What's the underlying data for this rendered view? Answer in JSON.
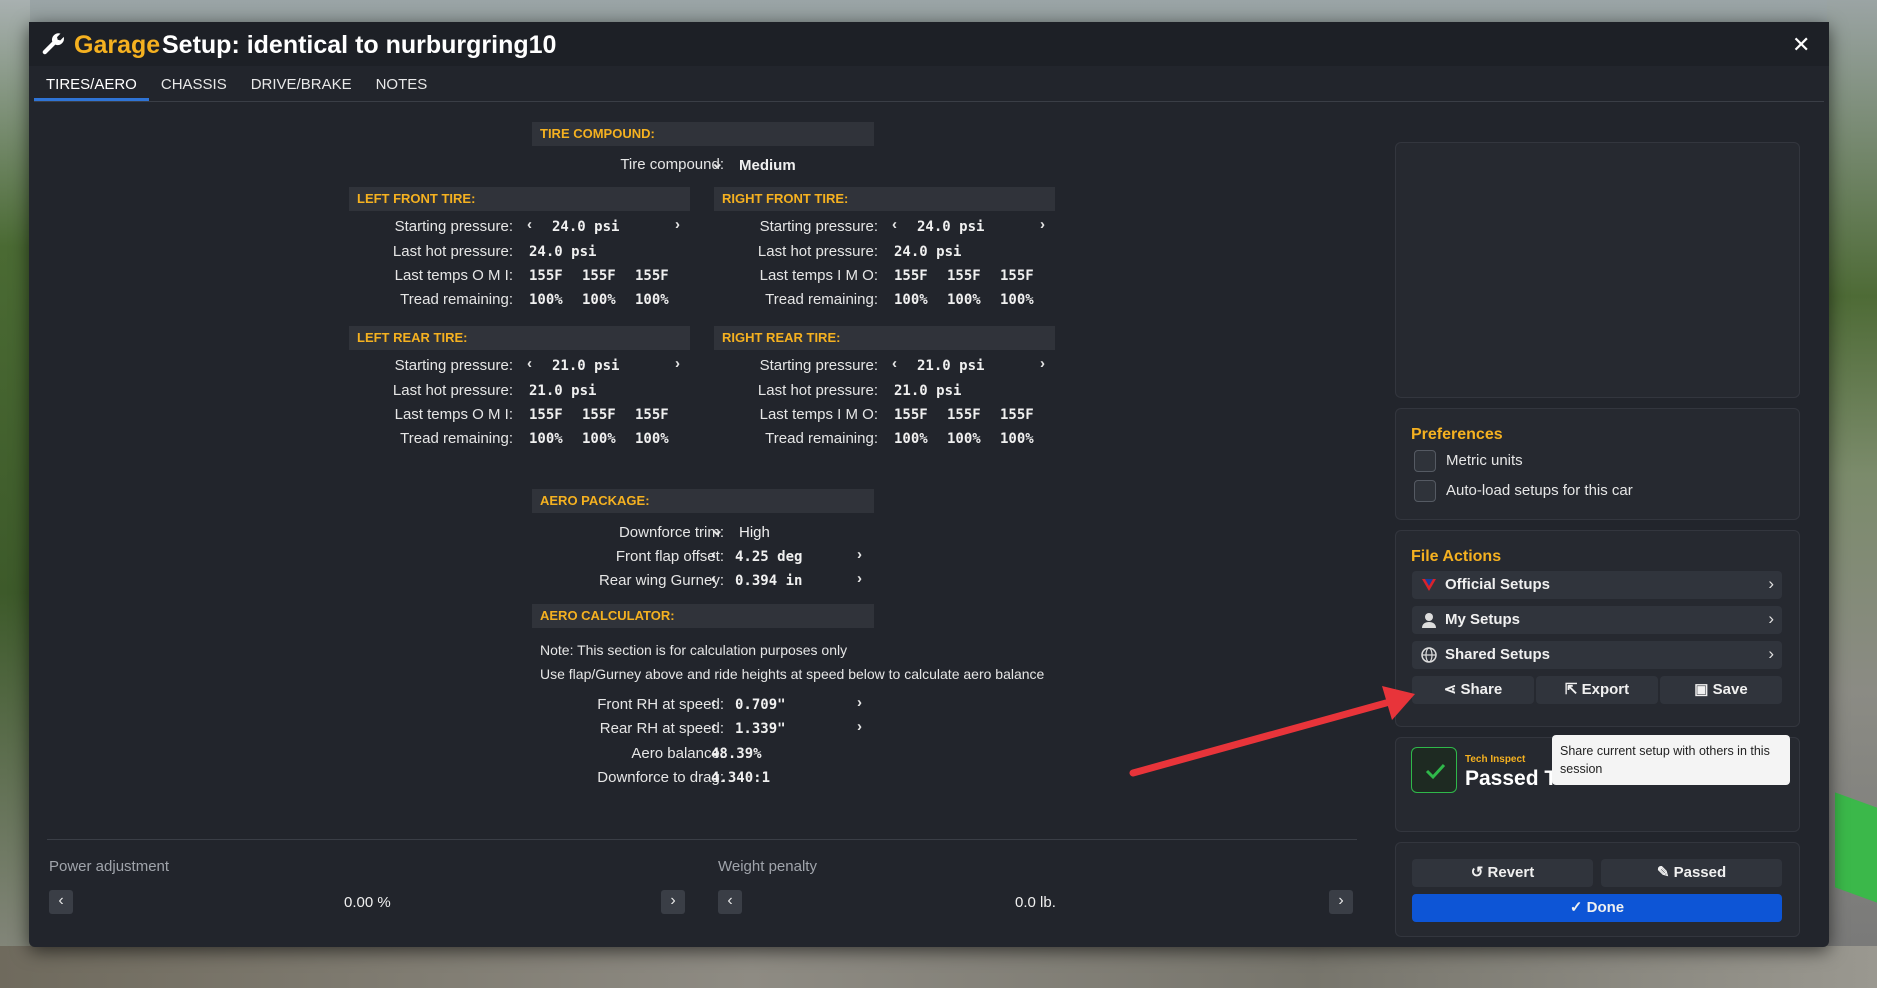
{
  "title": {
    "garage": "Garage",
    "setup": "Setup: identical to nurburgring10"
  },
  "tabs": [
    "TIRES/AERO",
    "CHASSIS",
    "DRIVE/BRAKE",
    "NOTES"
  ],
  "tire_compound": {
    "header": "TIRE COMPOUND:",
    "label": "Tire compound:",
    "value": "Medium"
  },
  "left_front": {
    "header": "LEFT FRONT TIRE:",
    "starting_label": "Starting pressure:",
    "starting": "24.0 psi",
    "hot_label": "Last hot pressure:",
    "hot": "24.0 psi",
    "temps_label": "Last temps O M I:",
    "temps": [
      "155F",
      "155F",
      "155F"
    ],
    "tread_label": "Tread remaining:",
    "tread": [
      "100%",
      "100%",
      "100%"
    ]
  },
  "right_front": {
    "header": "RIGHT FRONT TIRE:",
    "starting_label": "Starting pressure:",
    "starting": "24.0 psi",
    "hot_label": "Last hot pressure:",
    "hot": "24.0 psi",
    "temps_label": "Last temps I M O:",
    "temps": [
      "155F",
      "155F",
      "155F"
    ],
    "tread_label": "Tread remaining:",
    "tread": [
      "100%",
      "100%",
      "100%"
    ]
  },
  "left_rear": {
    "header": "LEFT REAR TIRE:",
    "starting_label": "Starting pressure:",
    "starting": "21.0 psi",
    "hot_label": "Last hot pressure:",
    "hot": "21.0 psi",
    "temps_label": "Last temps O M I:",
    "temps": [
      "155F",
      "155F",
      "155F"
    ],
    "tread_label": "Tread remaining:",
    "tread": [
      "100%",
      "100%",
      "100%"
    ]
  },
  "right_rear": {
    "header": "RIGHT REAR TIRE:",
    "starting_label": "Starting pressure:",
    "starting": "21.0 psi",
    "hot_label": "Last hot pressure:",
    "hot": "21.0 psi",
    "temps_label": "Last temps I M O:",
    "temps": [
      "155F",
      "155F",
      "155F"
    ],
    "tread_label": "Tread remaining:",
    "tread": [
      "100%",
      "100%",
      "100%"
    ]
  },
  "aero": {
    "header": "AERO PACKAGE:",
    "trim_label": "Downforce trim:",
    "trim": "High",
    "flap_label": "Front flap offset:",
    "flap": "4.25 deg",
    "gurney_label": "Rear wing Gurney:",
    "gurney": "0.394 in"
  },
  "calc": {
    "header": "AERO CALCULATOR:",
    "note1": "Note: This section is for calculation purposes only",
    "note2": "Use flap/Gurney above and ride heights at speed below to calculate aero balance",
    "front_rh_label": "Front RH at speed:",
    "front_rh": "0.709\"",
    "rear_rh_label": "Rear RH at speed:",
    "rear_rh": "1.339\"",
    "balance_label": "Aero balance:",
    "balance": "48.39%",
    "drag_label": "Downforce to drag:",
    "drag": "4.340:1"
  },
  "bottom": {
    "power_label": "Power adjustment",
    "power_value": "0.00 %",
    "weight_label": "Weight penalty",
    "weight_value": "0.0 lb."
  },
  "preferences": {
    "header": "Preferences",
    "metric": "Metric units",
    "autoload": "Auto-load setups for this car"
  },
  "file_actions": {
    "header": "File Actions",
    "official": "Official Setups",
    "my": "My Setups",
    "shared": "Shared Setups",
    "share": "Share",
    "export": "Export",
    "save": "Save"
  },
  "tooltip": "Share current setup with others in this session",
  "tech": {
    "small": "Tech Inspect",
    "status": "Passed Tech"
  },
  "buttons": {
    "revert": "Revert",
    "passed": "Passed",
    "done": "Done"
  },
  "colors": {
    "accent": "#f5b120",
    "primary": "#0d55d6",
    "pass_green": "#2fb84a",
    "arrow_red": "#e8343a"
  }
}
